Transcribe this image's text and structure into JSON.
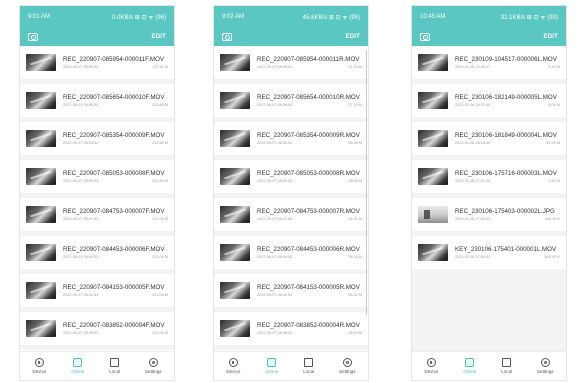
{
  "screens": [
    {
      "status_time": "9:01 AM",
      "status_right": "0.0KB/s ⊞ ⊡ ᯤ (96)",
      "edit_label": "EDIT",
      "items": [
        {
          "name": "REC_220907-085954-000011F.MOV",
          "date": "2022-09-07 08:59:54",
          "size": "170.31 M"
        },
        {
          "name": "REC_220907-085654-000010F.MOV",
          "date": "2022-09-07 08:56:54",
          "size": "220.88 M"
        },
        {
          "name": "REC_220907-085354-000009F.MOV",
          "date": "2022-09-07 08:53:54",
          "size": "219.82 M"
        },
        {
          "name": "REC_220907-085053-000008F.MOV",
          "date": "2022-09-07 08:50:53",
          "size": "221.80 M"
        },
        {
          "name": "REC_220907-084753-000007F.MOV",
          "date": "2022-09-07 08:47:53",
          "size": "221.06 M"
        },
        {
          "name": "REC_220907-084453-000006F.MOV",
          "date": "2022-09-07 08:44:53",
          "size": "221.06 M"
        },
        {
          "name": "REC_220907-084153-000005F.MOV",
          "date": "2022-09-07 08:41:53",
          "size": "221.06 M"
        },
        {
          "name": "REC_220907-083852-000004F.MOV",
          "date": "2022-09-07 08:38:52",
          "size": "221.06 M"
        }
      ]
    },
    {
      "status_time": "9:02 AM",
      "status_right": "45.8KB/s ⊞ ⊡ ᯤ (95)",
      "edit_label": "EDIT",
      "items": [
        {
          "name": "REC_220907-085954-000011R.MOV",
          "date": "2022-09-07 08:59:54",
          "size": "14.25 M"
        },
        {
          "name": "REC_220907-085654-000010R.MOV",
          "date": "2022-09-07 08:56:54",
          "size": "27.25 M"
        },
        {
          "name": "REC_220907-085354-000009R.MOV",
          "date": "2022-09-07 08:53:54",
          "size": "28.06 M"
        },
        {
          "name": "REC_220907-085053-000008R.MOV",
          "date": "2022-09-07 08:50:53",
          "size": "28.06 M"
        },
        {
          "name": "REC_220907-084753-000007R.MOV",
          "date": "2022-09-07 08:47:53",
          "size": "28.31 M"
        },
        {
          "name": "REC_220907-084453-000006R.MOV",
          "date": "2022-09-07 08:44:53",
          "size": "28.25 M"
        },
        {
          "name": "REC_220907-084153-000005R.MOV",
          "date": "2022-09-07 08:41:53",
          "size": "28.00 M"
        },
        {
          "name": "REC_220907-083852-000004R.MOV",
          "date": "2022-09-07 08:38:52",
          "size": "28.00 M"
        }
      ]
    },
    {
      "status_time": "10:45 AM",
      "status_right": "32.1KB/s ⊞ ⊡ ᯤ (93)",
      "edit_label": "EDIT",
      "items": [
        {
          "name": "REC_230109-104517-000006L.MOV",
          "date": "2023-01-09 10:45:17",
          "size": "4.43 M",
          "type": "video"
        },
        {
          "name": "REC_230106-182149-000005L.MOV",
          "date": "2023-01-06 18:21:49",
          "size": "8.06 M",
          "type": "video"
        },
        {
          "name": "REC_230106-181849-000004L.MOV",
          "date": "2023-01-06 18:18:49",
          "size": "53.94 M",
          "type": "video"
        },
        {
          "name": "REC_230106-175716-000003L.MOV",
          "date": "2023-01-06 17:57:16",
          "size": "2.50 M",
          "type": "video"
        },
        {
          "name": "REC_230106-175403-000002L.JPG",
          "date": "2023-01-06 17:54:03",
          "size": "190.30 K",
          "type": "image"
        },
        {
          "name": "KEY_230106-175401-000001L.MOV",
          "date": "2023-01-06 17:54:01",
          "size": "832.90 K",
          "type": "video"
        }
      ]
    }
  ],
  "tabs": [
    {
      "label": "Device",
      "icon": "device-icon"
    },
    {
      "label": "Online",
      "icon": "online-icon"
    },
    {
      "label": "Local",
      "icon": "local-folder-icon"
    },
    {
      "label": "Settings",
      "icon": "settings-icon"
    }
  ],
  "colors": {
    "accent": "#5ac7c3",
    "active_tab": "#4fc1bc",
    "background": "#f2f3f5"
  }
}
